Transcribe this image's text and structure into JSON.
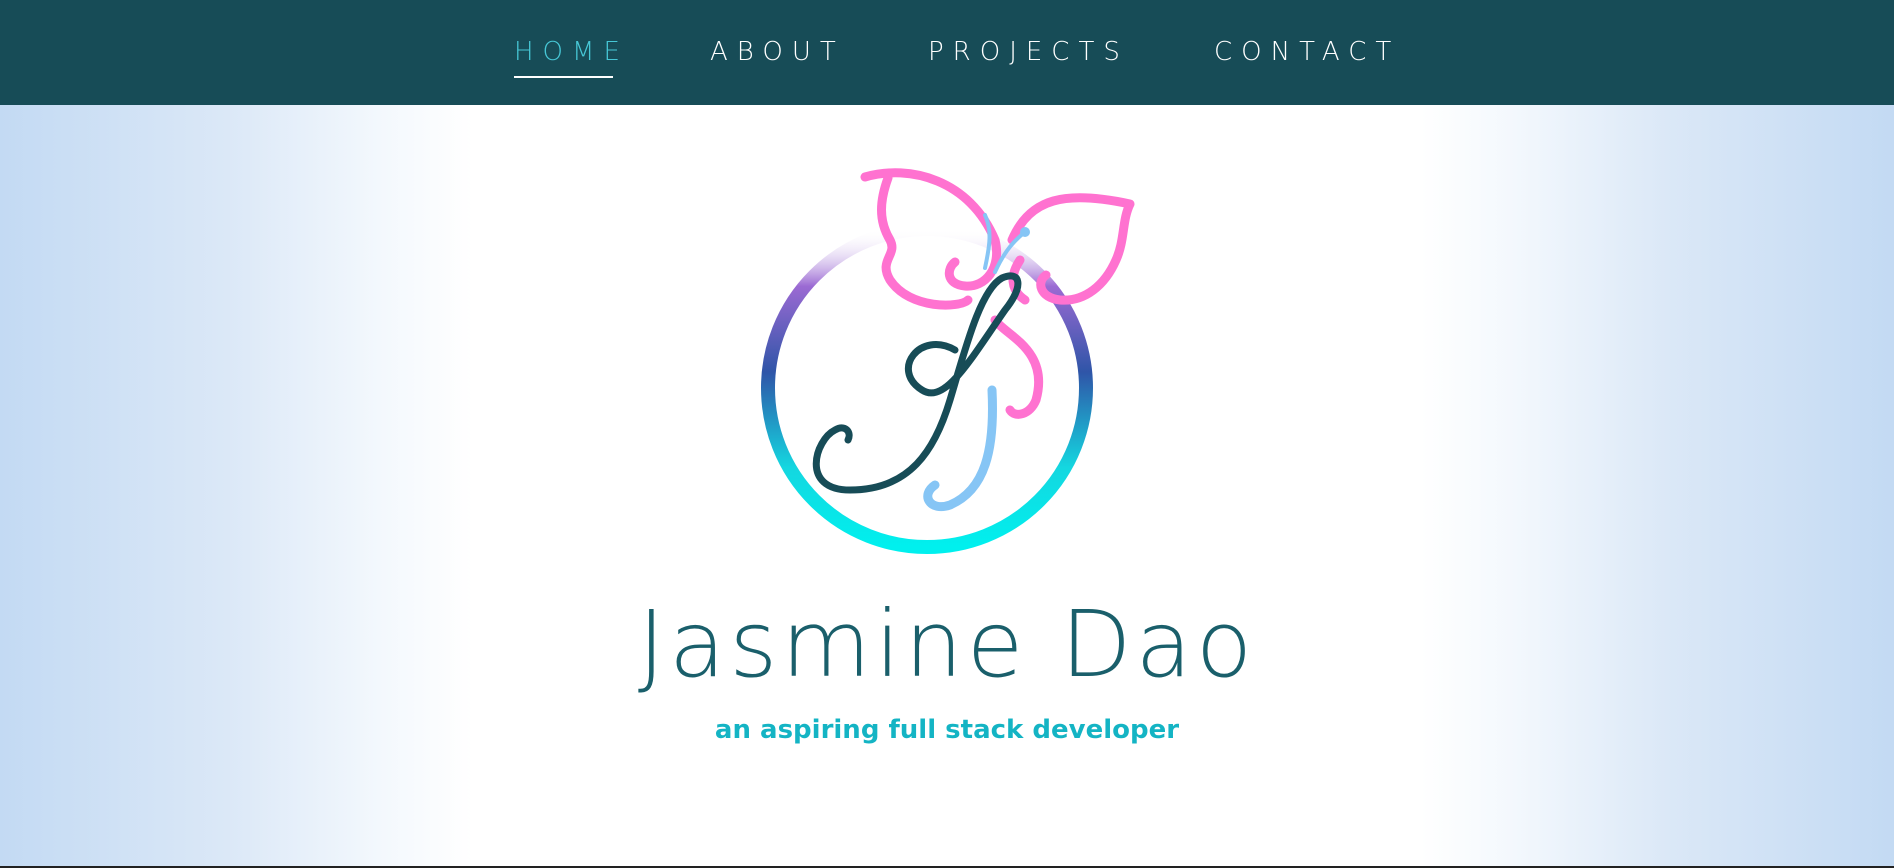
{
  "nav": {
    "items": [
      {
        "label": "HOME",
        "active": true
      },
      {
        "label": "ABOUT",
        "active": false
      },
      {
        "label": "PROJECTS",
        "active": false
      },
      {
        "label": "CONTACT",
        "active": false
      }
    ]
  },
  "hero": {
    "name": "Jasmine Dao",
    "tagline": "an aspiring full stack developer"
  },
  "colors": {
    "nav_background": "#174c57",
    "nav_active": "#47c7d6",
    "title_color": "#1a5f6b",
    "tagline_color": "#14b4c4",
    "butterfly_pink": "#ff6fcf",
    "accent_blue": "#86c5f5"
  },
  "logo": {
    "icons": [
      "butterfly-icon",
      "monogram-j"
    ]
  }
}
